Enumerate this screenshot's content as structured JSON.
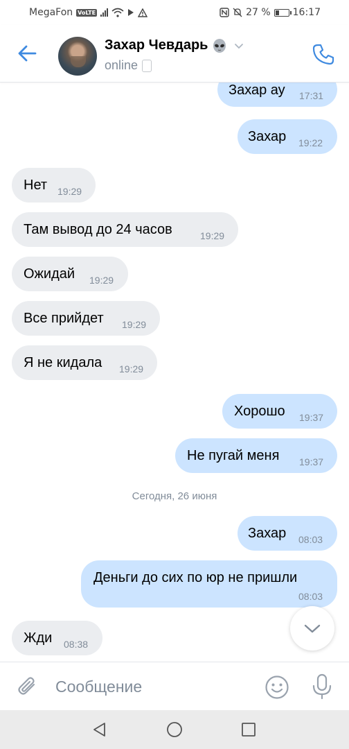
{
  "statusbar": {
    "carrier": "MegaFon",
    "volte": "VoLTE",
    "battery": "27 %",
    "battery_level": 0.27,
    "time": "16:17"
  },
  "header": {
    "name": "Захар Чевдарь",
    "status": "online",
    "accent": "#3f8ae0"
  },
  "messages": [
    {
      "dir": "out",
      "text": "Захар ау",
      "time": "17:31"
    },
    {
      "dir": "out",
      "text": "Захар",
      "time": "19:22"
    },
    {
      "dir": "in",
      "text": "Нет",
      "time": "19:29"
    },
    {
      "dir": "in",
      "text": "Там вывод до 24 часов",
      "time": "19:29"
    },
    {
      "dir": "in",
      "text": "Ожидай",
      "time": "19:29"
    },
    {
      "dir": "in",
      "text": "Все прийдет",
      "time": "19:29"
    },
    {
      "dir": "in",
      "text": "Я не кидала",
      "time": "19:29"
    },
    {
      "dir": "out",
      "text": "Хорошо",
      "time": "19:37"
    },
    {
      "dir": "out",
      "text": "Не пугай меня",
      "time": "19:37"
    },
    {
      "dir": "out",
      "text": "Захар",
      "time": "08:03"
    },
    {
      "dir": "out",
      "text": "Деньги до сих по юр не пришли",
      "time": "08:03"
    },
    {
      "dir": "in",
      "text": "Жди",
      "time": "08:38"
    }
  ],
  "date_separator": "Сегодня, 26 июня",
  "composer": {
    "placeholder": "Сообщение"
  },
  "colors": {
    "incoming_bubble": "#ebedf0",
    "outgoing_bubble": "#cce4ff",
    "secondary_text": "#818c99"
  }
}
